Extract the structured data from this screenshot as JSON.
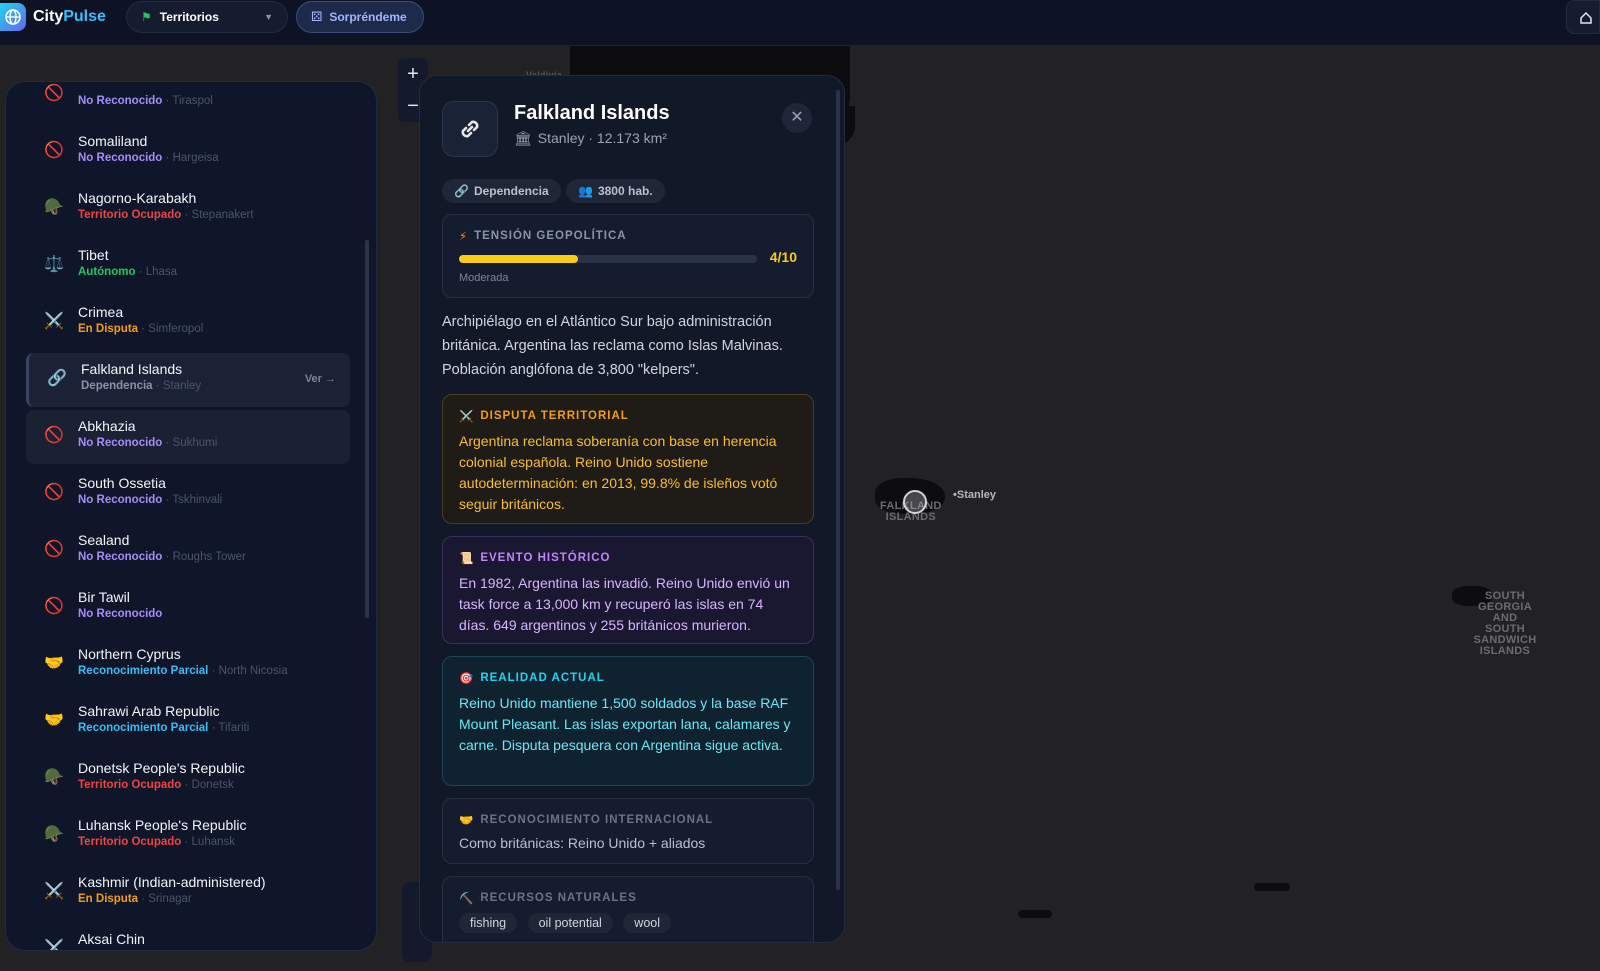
{
  "app": {
    "name_a": "City",
    "name_b": "Pulse"
  },
  "topbar": {
    "territorios_label": "Territorios",
    "sorprendeme_label": "Sorpréndeme"
  },
  "zoom": {
    "in": "+",
    "out": "−"
  },
  "map": {
    "labels": {
      "falkland": "FALKLAND\nISLANDS",
      "stanley": "•Stanley",
      "south_georgia": "SOUTH\nGEORGIA\nAND\nSOUTH\nSANDWICH\nISLANDS",
      "valdivia": "Valdivia"
    }
  },
  "sidebar": {
    "items": [
      {
        "name": "",
        "status": "No Reconocido",
        "capital": "Tiraspol",
        "icon": "🚫",
        "cls": "s-nr"
      },
      {
        "name": "Somaliland",
        "status": "No Reconocido",
        "capital": "Hargeisa",
        "icon": "🚫",
        "cls": "s-nr"
      },
      {
        "name": "Nagorno-Karabakh",
        "status": "Territorio Ocupado",
        "capital": "Stepanakert",
        "icon": "🪖",
        "cls": "s-to"
      },
      {
        "name": "Tibet",
        "status": "Autónomo",
        "capital": "Lhasa",
        "icon": "⚖️",
        "cls": "s-au"
      },
      {
        "name": "Crimea",
        "status": "En Disputa",
        "capital": "Simferopol",
        "icon": "⚔️",
        "cls": "s-ed"
      },
      {
        "name": "Falkland Islands",
        "status": "Dependencia",
        "capital": "Stanley",
        "icon": "🔗",
        "cls": "s-de",
        "ver": "Ver →"
      },
      {
        "name": "Abkhazia",
        "status": "No Reconocido",
        "capital": "Sukhumi",
        "icon": "🚫",
        "cls": "s-nr"
      },
      {
        "name": "South Ossetia",
        "status": "No Reconocido",
        "capital": "Tskhinvali",
        "icon": "🚫",
        "cls": "s-nr"
      },
      {
        "name": "Sealand",
        "status": "No Reconocido",
        "capital": "Roughs Tower",
        "icon": "🚫",
        "cls": "s-nr"
      },
      {
        "name": "Bir Tawil",
        "status": "No Reconocido",
        "capital": "",
        "icon": "🚫",
        "cls": "s-nr"
      },
      {
        "name": "Northern Cyprus",
        "status": "Reconocimiento Parcial",
        "capital": "North Nicosia",
        "icon": "🤝",
        "cls": "s-rp"
      },
      {
        "name": "Sahrawi Arab Republic",
        "status": "Reconocimiento Parcial",
        "capital": "Tifariti",
        "icon": "🤝",
        "cls": "s-rp"
      },
      {
        "name": "Donetsk People's Republic",
        "status": "Territorio Ocupado",
        "capital": "Donetsk",
        "icon": "🪖",
        "cls": "s-to"
      },
      {
        "name": "Luhansk People's Republic",
        "status": "Territorio Ocupado",
        "capital": "Luhansk",
        "icon": "🪖",
        "cls": "s-to"
      },
      {
        "name": "Kashmir (Indian-administered)",
        "status": "En Disputa",
        "capital": "Srinagar",
        "icon": "⚔️",
        "cls": "s-ed"
      },
      {
        "name": "Aksai Chin",
        "status": "",
        "capital": "",
        "icon": "⚔️",
        "cls": "s-ed"
      }
    ]
  },
  "panel": {
    "title": "Falkland Islands",
    "subtitle": "Stanley · 12.173 km²",
    "chips": {
      "type": "Dependencia",
      "population": "3800 hab."
    },
    "tension": {
      "label": "TENSIÓN GEOPOLÍTICA",
      "score": "4/10",
      "value": 0.4,
      "level": "Moderada"
    },
    "description": "Archipiélago en el Atlántico Sur bajo administración británica. Argentina las reclama como Islas Malvinas. Población anglófona de 3,800 \"kelpers\".",
    "dispute": {
      "label": "DISPUTA TERRITORIAL",
      "text": "Argentina reclama soberanía con base en herencia colonial española. Reino Unido sostiene autodeterminación: en 2013, 99.8% de isleños votó seguir británicos."
    },
    "history": {
      "label": "EVENTO HISTÓRICO",
      "text": "En 1982, Argentina las invadió. Reino Unido envió un task force a 13,000 km y recuperó las islas en 74 días. 649 argentinos y 255 británicos murieron."
    },
    "reality": {
      "label": "REALIDAD ACTUAL",
      "text": "Reino Unido mantiene 1,500 soldados y la base RAF Mount Pleasant. Las islas exportan lana, calamares y carne. Disputa pesquera con Argentina sigue activa."
    },
    "recognition": {
      "label": "RECONOCIMIENTO INTERNACIONAL",
      "text": "Como británicas: Reino Unido + aliados"
    },
    "resources": {
      "label": "RECURSOS NATURALES",
      "tags": [
        "fishing",
        "oil potential",
        "wool"
      ]
    }
  }
}
